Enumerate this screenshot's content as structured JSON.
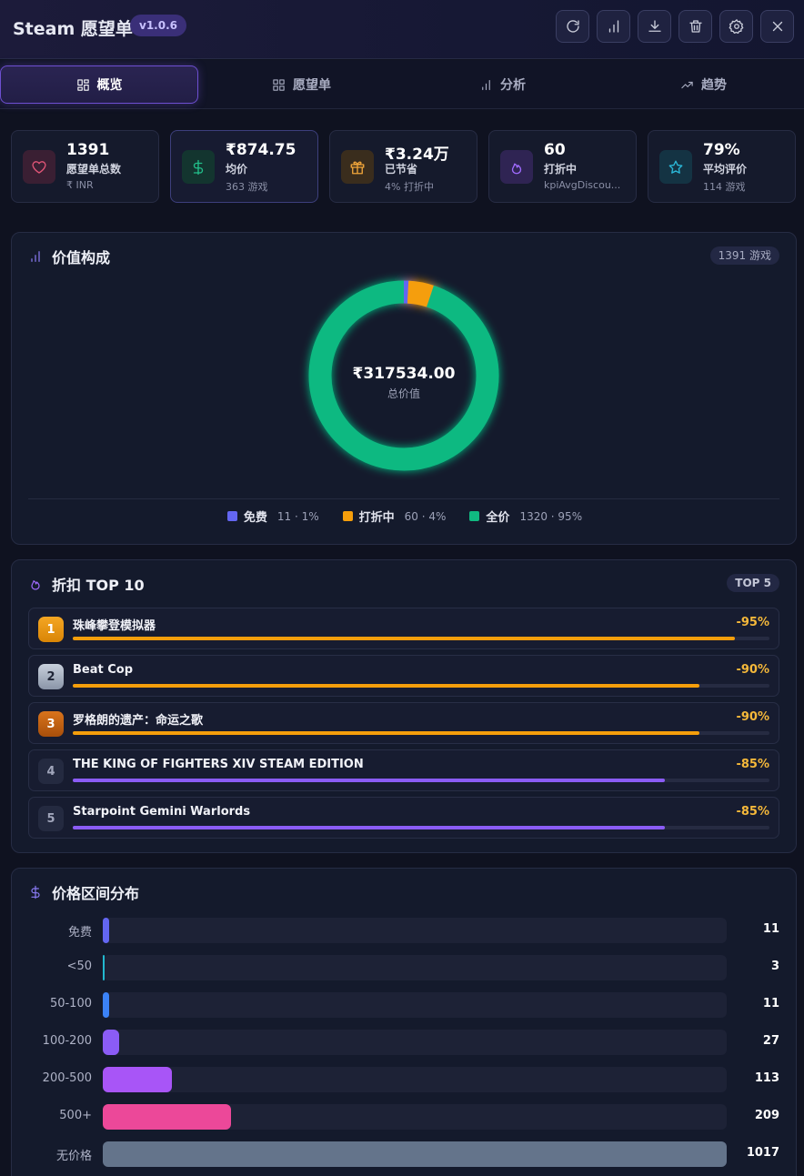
{
  "header": {
    "title": "Steam 愿望单",
    "version": "v1.0.6"
  },
  "tabs": [
    {
      "label": "概览",
      "icon": "layout-grid-icon",
      "active": true
    },
    {
      "label": "愿望单",
      "icon": "grid-icon"
    },
    {
      "label": "分析",
      "icon": "bar-chart-icon"
    },
    {
      "label": "趋势",
      "icon": "trending-up-icon"
    }
  ],
  "kpis": [
    {
      "value": "1391",
      "label": "愿望单总数",
      "sub": "₹ INR",
      "icon": "heart-icon",
      "color": "#e05577"
    },
    {
      "value": "₹874.75",
      "label": "均价",
      "sub": "363 游戏",
      "icon": "dollar-icon",
      "color": "#22c08a"
    },
    {
      "value": "₹3.24万",
      "label": "已节省",
      "sub": "4% 打折中",
      "icon": "gift-icon",
      "color": "#f0a53a"
    },
    {
      "value": "60",
      "label": "打折中",
      "sub": "kpiAvgDiscou...",
      "icon": "flame-icon",
      "color": "#a06bff"
    },
    {
      "value": "79%",
      "label": "平均评价",
      "sub": "114 游戏",
      "icon": "star-icon",
      "color": "#2bb8d8"
    }
  ],
  "composition": {
    "title": "价值构成",
    "badge": "1391 游戏",
    "total_value": "₹317534.00",
    "total_label": "总价值",
    "segments": [
      {
        "name": "免费",
        "count": 11,
        "percent": 1,
        "color": "#6366f1",
        "text": "11 · 1%"
      },
      {
        "name": "打折中",
        "count": 60,
        "percent": 4,
        "color": "#f59e0b",
        "text": "60 · 4%"
      },
      {
        "name": "全价",
        "count": 1320,
        "percent": 95,
        "color": "#10b981",
        "text": "1320 · 95%"
      }
    ]
  },
  "discounts": {
    "title": "折扣 TOP 10",
    "badge": "TOP 5",
    "items": [
      {
        "rank": "1",
        "name": "珠峰攀登模拟器",
        "pct": "-95%",
        "discount": 95,
        "color": "#f59e0b"
      },
      {
        "rank": "2",
        "name": "Beat Cop",
        "pct": "-90%",
        "discount": 90,
        "color": "#f59e0b"
      },
      {
        "rank": "3",
        "name": "罗格朗的遗产：命运之歌",
        "pct": "-90%",
        "discount": 90,
        "color": "#f59e0b"
      },
      {
        "rank": "4",
        "name": "THE KING OF FIGHTERS XIV STEAM EDITION",
        "pct": "-85%",
        "discount": 85,
        "color": "#8b5cf6"
      },
      {
        "rank": "5",
        "name": "Starpoint Gemini Warlords",
        "pct": "-85%",
        "discount": 85,
        "color": "#8b5cf6"
      }
    ]
  },
  "price_dist": {
    "title": "价格区间分布",
    "rows": [
      {
        "label": "免费",
        "count": "11",
        "value": 11,
        "color": "#6366f1"
      },
      {
        "label": "<50",
        "count": "3",
        "value": 3,
        "color": "#22b8cf"
      },
      {
        "label": "50-100",
        "count": "11",
        "value": 11,
        "color": "#3b82f6"
      },
      {
        "label": "100-200",
        "count": "27",
        "value": 27,
        "color": "#8b5cf6"
      },
      {
        "label": "200-500",
        "count": "113",
        "value": 113,
        "color": "#a855f7"
      },
      {
        "label": "500+",
        "count": "209",
        "value": 209,
        "color": "#ec4899"
      },
      {
        "label": "无价格",
        "count": "1017",
        "value": 1017,
        "color": "#64748b"
      }
    ]
  }
}
